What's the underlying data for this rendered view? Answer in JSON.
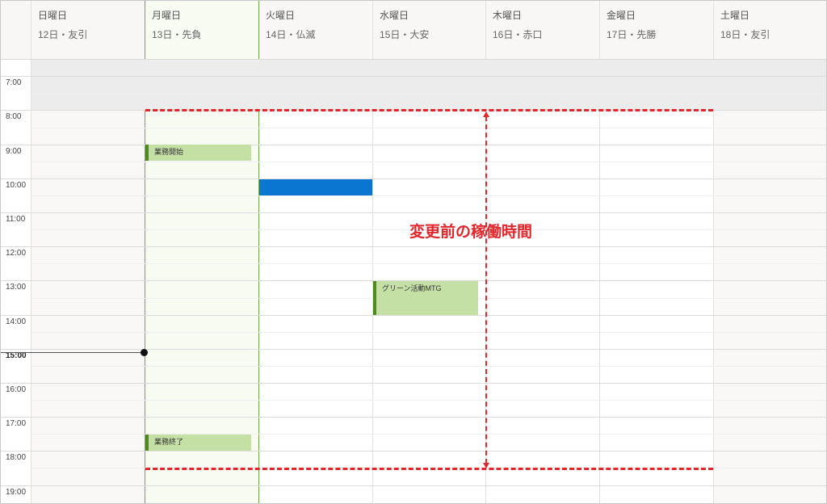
{
  "days": [
    {
      "name": "日曜日",
      "sub": "12日・友引"
    },
    {
      "name": "月曜日",
      "sub": "13日・先負"
    },
    {
      "name": "火曜日",
      "sub": "14日・仏滅"
    },
    {
      "name": "水曜日",
      "sub": "15日・大安"
    },
    {
      "name": "木曜日",
      "sub": "16日・赤口"
    },
    {
      "name": "金曜日",
      "sub": "17日・先勝"
    },
    {
      "name": "土曜日",
      "sub": "18日・友引"
    }
  ],
  "hours": [
    "7:00",
    "8:00",
    "9:00",
    "10:00",
    "11:00",
    "12:00",
    "13:00",
    "14:00",
    "15:00",
    "16:00",
    "17:00",
    "18:00",
    "19:00"
  ],
  "current_time_label": "15:00",
  "events": {
    "work_start": "業務開始",
    "green_mtg": "グリーン活動MTG",
    "work_end": "業務終了",
    "blue_block": ""
  },
  "annotation": {
    "text": "変更前の稼働時間",
    "color": "#e3262b"
  },
  "colors": {
    "today_border": "#6fa84a",
    "event_green": "#c5e0a5",
    "event_green_accent": "#4f8a1f",
    "event_blue": "#0a76d1"
  }
}
